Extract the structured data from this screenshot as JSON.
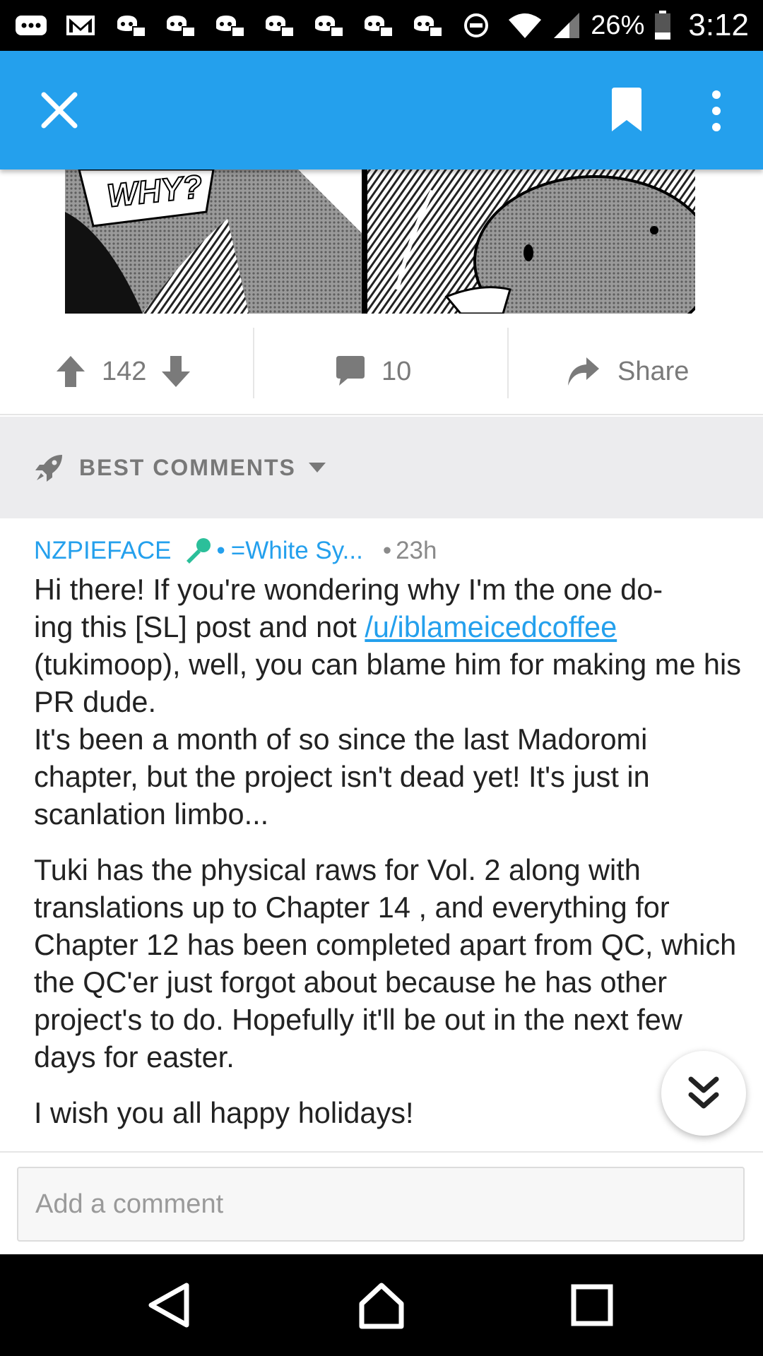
{
  "status_bar": {
    "battery_text": "26%",
    "time": "3:12",
    "notification_icons": [
      "messages-icon",
      "gmail-icon",
      "discord-icon",
      "discord-icon",
      "discord-icon",
      "discord-icon",
      "discord-icon",
      "discord-icon",
      "discord-icon",
      "do-not-disturb-icon"
    ],
    "system_icons": [
      "wifi-icon",
      "signal-icon",
      "battery-icon"
    ]
  },
  "app_bar": {
    "close_icon": "close-icon",
    "bookmark_icon": "bookmark-icon",
    "more_icon": "more-vertical-icon",
    "color": "#24a0ed"
  },
  "post": {
    "image_text": "WHY?",
    "score": "142",
    "comment_count": "10",
    "share_label": "Share"
  },
  "sort": {
    "label": "BEST COMMENTS",
    "icon": "rocket-icon"
  },
  "comment": {
    "author": "NZPIEFACE",
    "flair_icon": "microphone-icon",
    "flair_text": "=White Sy...",
    "time": "23h",
    "para1_line1": "Hi there! If you're wondering why I'm the one do-",
    "para1_line2_pre": "ing this [SL] post and not ",
    "para1_link": "/u/iblameicedcoffee",
    "para1_rest": "(tukimoop), well, you can blame him for making me his PR dude.",
    "para1b": "It's been a month of so since the last Madoromi chapter, but the project isn't dead yet! It's just in scanlation limbo...",
    "para2": "Tuki has the physical raws for Vol. 2 along with translations up to Chapter 14 , and everything for Chapter 12 has been completed apart from QC, which the QC'er just forgot about because he has other project's to do. Hopefully it'll be out in the next few days for easter.",
    "para3": "I wish you all happy holidays!"
  },
  "jump_button_icon": "chevrons-down-icon",
  "add_comment": {
    "placeholder": "Add a comment"
  },
  "nav_bar": {
    "back": "back-icon",
    "home": "home-icon",
    "recents": "recents-icon"
  }
}
